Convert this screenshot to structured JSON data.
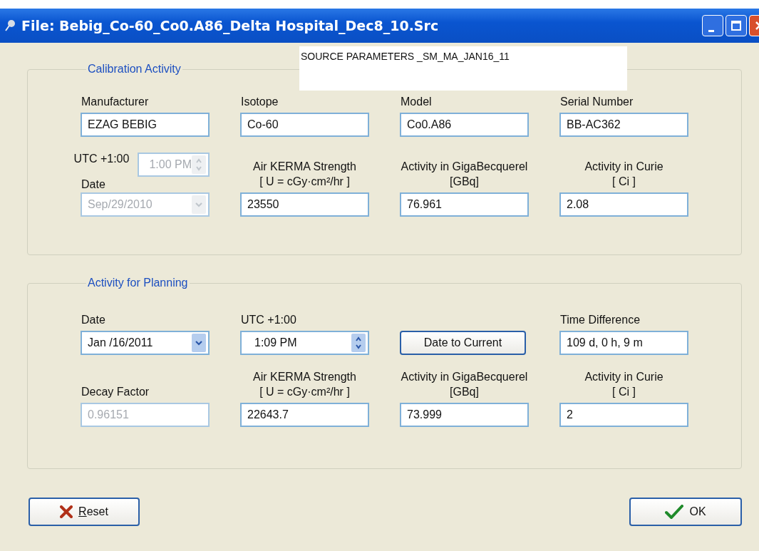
{
  "window": {
    "title": "File:  Bebig_Co-60_Co0.A86_Delta Hospital_Dec8_10.Src"
  },
  "note": "SOURCE PARAMETERS _SM_MA_JAN16_11",
  "groups": [
    {
      "title": "Calibration Activity",
      "rows": [
        [
          {
            "kind": "text",
            "label": "Manufacturer",
            "value": "EZAG BEBIG",
            "disabled": false
          },
          {
            "kind": "text",
            "label": "Isotope",
            "value": "Co-60",
            "disabled": false
          },
          {
            "kind": "text",
            "label": "Model",
            "value": "Co0.A86",
            "disabled": false
          },
          {
            "kind": "text",
            "label": "Serial Number",
            "value": "BB-AC362",
            "disabled": false
          }
        ],
        [
          {
            "kind": "datetime",
            "time_label": "UTC +1:00",
            "time": "1:00 PM",
            "date_label": "Date",
            "date": "Sep/29/2010",
            "disabled": true
          },
          {
            "kind": "text",
            "label": "Air KERMA Strength",
            "unit": "[ U = cGy·cm²/hr ]",
            "value": "23550",
            "disabled": false
          },
          {
            "kind": "text",
            "label": "Activity in GigaBecquerel",
            "unit": "[GBq]",
            "value": "76.961",
            "disabled": false
          },
          {
            "kind": "text",
            "label": "Activity in Curie",
            "unit": "[ Ci ]",
            "value": "2.08",
            "disabled": false
          }
        ]
      ]
    },
    {
      "title": "Activity for Planning",
      "rows": [
        [
          {
            "kind": "date",
            "label": "Date",
            "value": "Jan /16/2011",
            "disabled": false
          },
          {
            "kind": "time",
            "label": "UTC +1:00",
            "value": "1:09 PM",
            "disabled": false
          },
          {
            "kind": "button",
            "label": "Date to Current"
          },
          {
            "kind": "text",
            "label": "Time Difference",
            "value": "109 d, 0 h, 9 m",
            "disabled": false
          }
        ],
        [
          {
            "kind": "text",
            "label": "Decay Factor",
            "value": "0.96151",
            "disabled": true
          },
          {
            "kind": "text",
            "label": "Air KERMA Strength",
            "unit": "[ U = cGy·cm²/hr ]",
            "value": "22643.7",
            "disabled": false
          },
          {
            "kind": "text",
            "label": "Activity in GigaBecquerel",
            "unit": "[GBq]",
            "value": "73.999",
            "disabled": false
          },
          {
            "kind": "text",
            "label": "Activity in Curie",
            "unit": "[ Ci ]",
            "value": "2",
            "disabled": false
          }
        ]
      ]
    }
  ],
  "buttons": [
    {
      "kind": "reset",
      "label": "Reset"
    },
    {
      "kind": "ok",
      "label": "OK"
    }
  ]
}
